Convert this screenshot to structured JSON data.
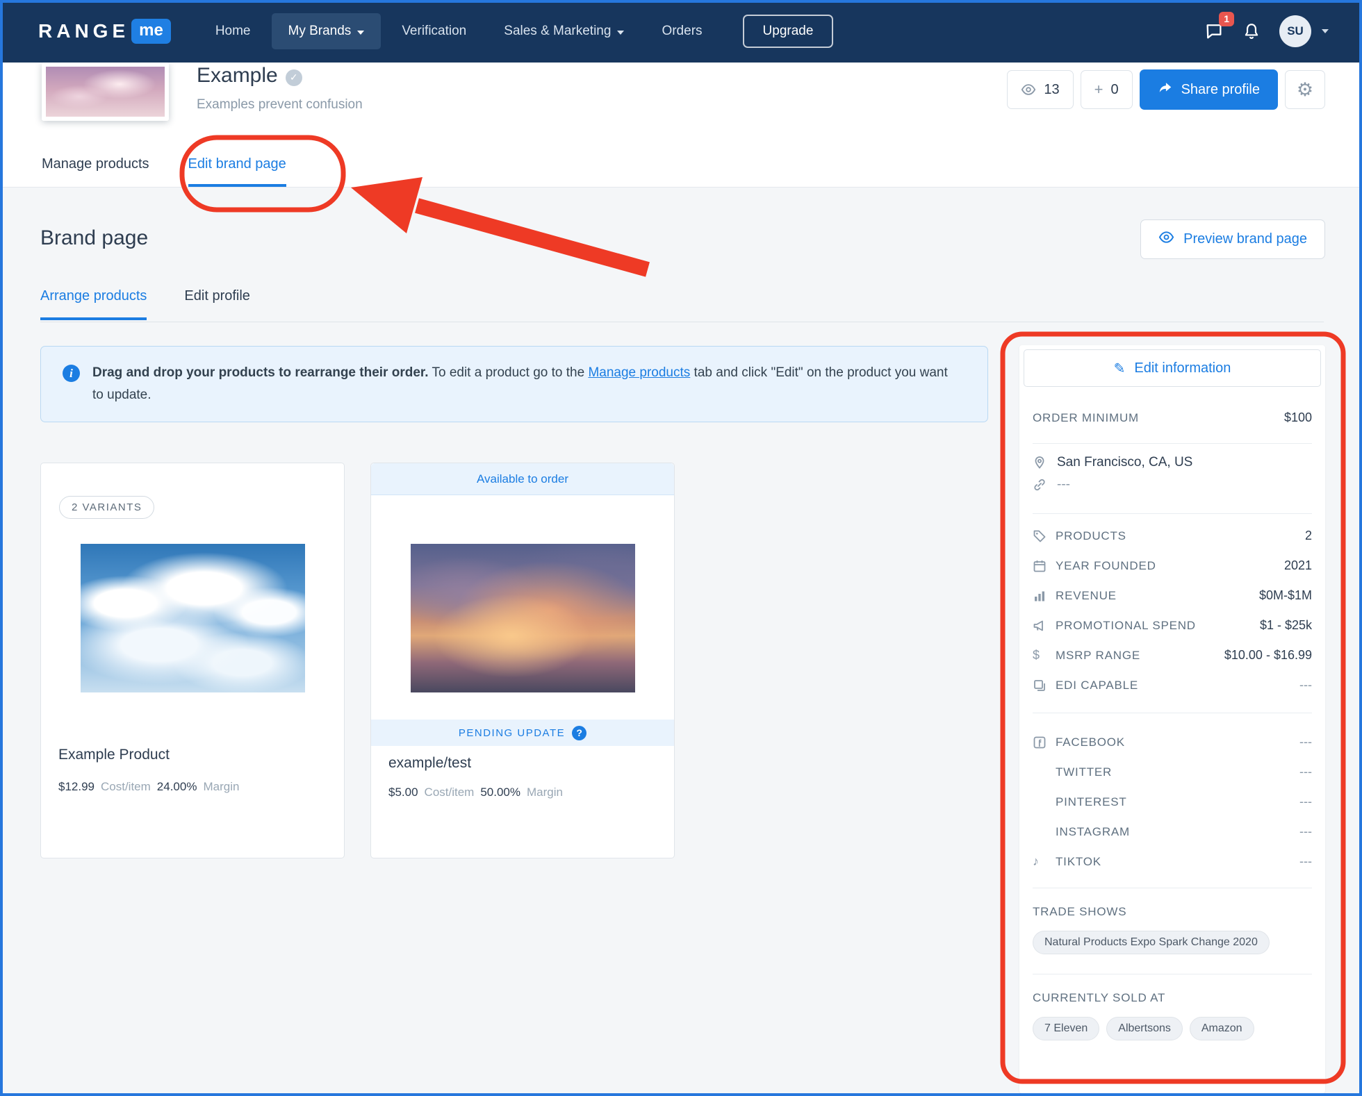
{
  "nav": {
    "logo_range": "RANGE",
    "logo_me": "me",
    "items": [
      {
        "label": "Home"
      },
      {
        "label": "My Brands"
      },
      {
        "label": "Verification"
      },
      {
        "label": "Sales & Marketing"
      },
      {
        "label": "Orders"
      }
    ],
    "upgrade_label": "Upgrade",
    "notification_count": "1",
    "avatar_initials": "SU"
  },
  "brand_header": {
    "title": "Example",
    "subtitle": "Examples prevent confusion",
    "views": "13",
    "adds_count": "0",
    "share_label": "Share profile"
  },
  "brand_tabs": {
    "manage_products": "Manage products",
    "edit_brand_page": "Edit brand page"
  },
  "page": {
    "title": "Brand page",
    "preview_button": "Preview brand page",
    "subtab_arrange": "Arrange products",
    "subtab_edit_profile": "Edit profile"
  },
  "alert": {
    "bold": "Drag and drop your products to rearrange their order.",
    "before_link": " To edit a product go to the ",
    "link": "Manage products",
    "after_link": " tab and click \"Edit\" on the product you want to update."
  },
  "products": [
    {
      "variants_badge": "2 VARIANTS",
      "name": "Example Product",
      "price": "$12.99",
      "cost_label": "Cost/item",
      "margin": "24.00%",
      "margin_label": "Margin"
    },
    {
      "banner": "Available to order",
      "status": "PENDING UPDATE",
      "name": "example/test",
      "price": "$5.00",
      "cost_label": "Cost/item",
      "margin": "50.00%",
      "margin_label": "Margin"
    }
  ],
  "sidebar": {
    "edit_button": "Edit information",
    "order_minimum": {
      "label": "ORDER MINIMUM",
      "value": "$100"
    },
    "location": "San Francisco, CA, US",
    "website": "---",
    "stats": [
      {
        "icon": "tag",
        "label": "PRODUCTS",
        "value": "2"
      },
      {
        "icon": "calendar",
        "label": "YEAR FOUNDED",
        "value": "2021"
      },
      {
        "icon": "bar-chart",
        "label": "REVENUE",
        "value": "$0M-$1M"
      },
      {
        "icon": "megaphone",
        "label": "PROMOTIONAL SPEND",
        "value": "$1 - $25k"
      },
      {
        "icon": "dollar",
        "label": "MSRP RANGE",
        "value": "$10.00 - $16.99"
      },
      {
        "icon": "copy",
        "label": "EDI CAPABLE",
        "value": "---"
      }
    ],
    "social": [
      {
        "icon": "facebook",
        "label": "FACEBOOK",
        "value": "---"
      },
      {
        "icon": "",
        "label": "TWITTER",
        "value": "---"
      },
      {
        "icon": "",
        "label": "PINTEREST",
        "value": "---"
      },
      {
        "icon": "",
        "label": "INSTAGRAM",
        "value": "---"
      },
      {
        "icon": "tiktok",
        "label": "TIKTOK",
        "value": "---"
      }
    ],
    "trade_shows": {
      "label": "TRADE SHOWS",
      "chips": [
        "Natural Products Expo Spark Change 2020"
      ]
    },
    "sold_at": {
      "label": "CURRENTLY SOLD AT",
      "chips": [
        "7 Eleven",
        "Albertsons",
        "Amazon"
      ]
    }
  },
  "colors": {
    "accent_blue": "#1b7de2",
    "nav_navy": "#17365d",
    "annotation_red": "#ee3a25",
    "page_bg": "#f4f6f8"
  }
}
